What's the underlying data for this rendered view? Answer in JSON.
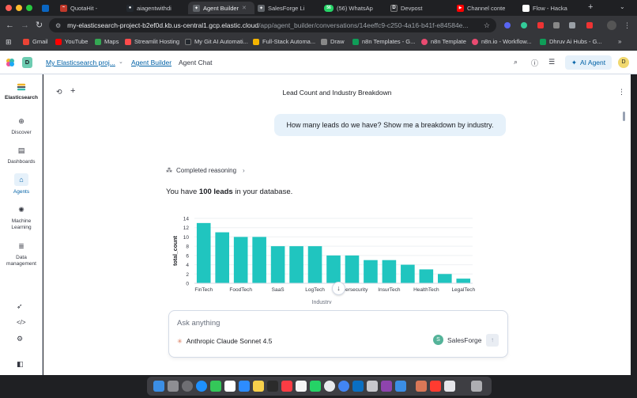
{
  "browser": {
    "tabs": [
      {
        "label": "QuotaHit -",
        "color": "#c0392b",
        "glyph": "~"
      },
      {
        "label": "aiagentwithdi",
        "color": "#24292f",
        "glyph": "●"
      },
      {
        "label": "Agent Builder",
        "color": "#8a8d93",
        "glyph": "✦"
      },
      {
        "label": "SalesForge Li",
        "color": "#8a8d93",
        "glyph": "✦"
      },
      {
        "label": "(56) WhatsAp",
        "color": "#25d366",
        "glyph": "56"
      },
      {
        "label": "Devpost",
        "color": "#2b2d31",
        "glyph": "D"
      },
      {
        "label": "Channel conte",
        "color": "#ff0000",
        "glyph": "▶"
      },
      {
        "label": "Flow - Hacka",
        "color": "#ffffff",
        "glyph": ""
      }
    ],
    "url_main": "my-elasticsearch-project-b2ef0d.kb.us-central1.gcp.elastic.cloud",
    "url_rest": "/app/agent_builder/conversations/14eeffc9-c250-4a16-b41f-e84584e...",
    "bookmarks": [
      {
        "label": "Gmail",
        "color": "#ea4335"
      },
      {
        "label": "YouTube",
        "color": "#ff0000"
      },
      {
        "label": "Maps",
        "color": "#34a853"
      },
      {
        "label": "Streamlit Hosting",
        "color": "#ff4b4b"
      },
      {
        "label": "My Git AI Automati...",
        "color": "#24292f"
      },
      {
        "label": "Full-Stack Automa...",
        "color": "#f4b400"
      },
      {
        "label": "Draw",
        "color": "#888888"
      },
      {
        "label": "n8n Templates - G...",
        "color": "#0f9d58"
      },
      {
        "label": "n8n Template",
        "color": "#ea4b71"
      },
      {
        "label": "n8n.io - Workflow...",
        "color": "#ea4b71"
      },
      {
        "label": "Dhruv Ai Hubs - G...",
        "color": "#0f9d58"
      }
    ]
  },
  "header": {
    "space_initial": "D",
    "breadcrumbs": [
      "My Elasticsearch proj...",
      "Agent Builder",
      "Agent Chat"
    ],
    "ai_agent_label": "AI Agent",
    "user_initial": "D"
  },
  "nav": {
    "brand": "Elasticsearch",
    "items": [
      {
        "label": "Discover",
        "icon": "compass-icon"
      },
      {
        "label": "Dashboards",
        "icon": "dashboard-icon"
      },
      {
        "label": "Agents",
        "icon": "robot-icon"
      },
      {
        "label": "Machine Learning",
        "icon": "ml-icon"
      },
      {
        "label": "Data management",
        "icon": "database-icon"
      }
    ]
  },
  "conversation": {
    "title": "Lead Count and Industry Breakdown",
    "user_message": "How many leads do we have? Show me a breakdown by industry.",
    "reasoning_label": "Completed reasoning",
    "answer_prefix": "You have ",
    "answer_bold": "100 leads",
    "answer_suffix": " in your database."
  },
  "composer": {
    "placeholder": "Ask anything",
    "model": "Anthropic Claude Sonnet 4.5",
    "agent": "SalesForge",
    "agent_initial": "S"
  },
  "chart_data": {
    "type": "bar",
    "xlabel": "Industry",
    "ylabel": "total_count",
    "ylim": [
      0,
      14
    ],
    "yticks": [
      0,
      2,
      4,
      6,
      8,
      10,
      12,
      14
    ],
    "bar_color": "#20c5bf",
    "categories": [
      "FinTech",
      "",
      "FoodTech",
      "",
      "SaaS",
      "",
      "LogTech",
      "",
      "Cybersecurity",
      "",
      "InsurTech",
      "",
      "HealthTech",
      "",
      "LegalTech"
    ],
    "values": [
      13,
      11,
      10,
      10,
      8,
      8,
      8,
      6,
      6,
      5,
      5,
      4,
      3,
      2,
      1
    ]
  }
}
